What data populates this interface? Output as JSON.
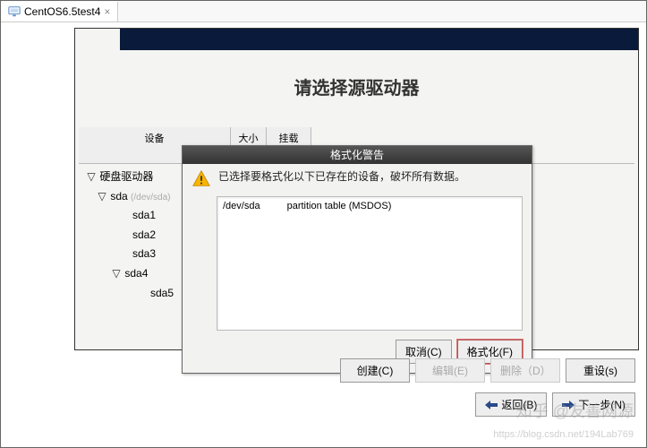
{
  "tab": {
    "label": "CentOS6.5test4",
    "close": "×"
  },
  "installer": {
    "title": "请选择源驱动器",
    "columns": {
      "device": "设备",
      "size": "大小",
      "mount": "挂载点/"
    },
    "tree": {
      "root": "硬盘驱动器",
      "sda": "sda",
      "sda_path": "(/dev/sda)",
      "sda1": "sda1",
      "sda2": "sda2",
      "sda3": "sda3",
      "sda4": "sda4",
      "sda5": "sda5"
    }
  },
  "modal": {
    "title": "格式化警告",
    "message": "已选择要格式化以下已存在的设备，破坏所有数据。",
    "device": "/dev/sda",
    "detail": "partition table (MSDOS)",
    "cancel": "取消(C)",
    "format": "格式化(F)"
  },
  "actions": {
    "create": "创建(C)",
    "edit": "编辑(E)",
    "delete": "删除（D）",
    "reset": "重设(s)"
  },
  "nav": {
    "back": "返回(B)",
    "next": "下一步(N)"
  },
  "watermark": {
    "line1": "知乎 @友善网源",
    "line2": "https://blog.csdn.net/194Lab769"
  }
}
